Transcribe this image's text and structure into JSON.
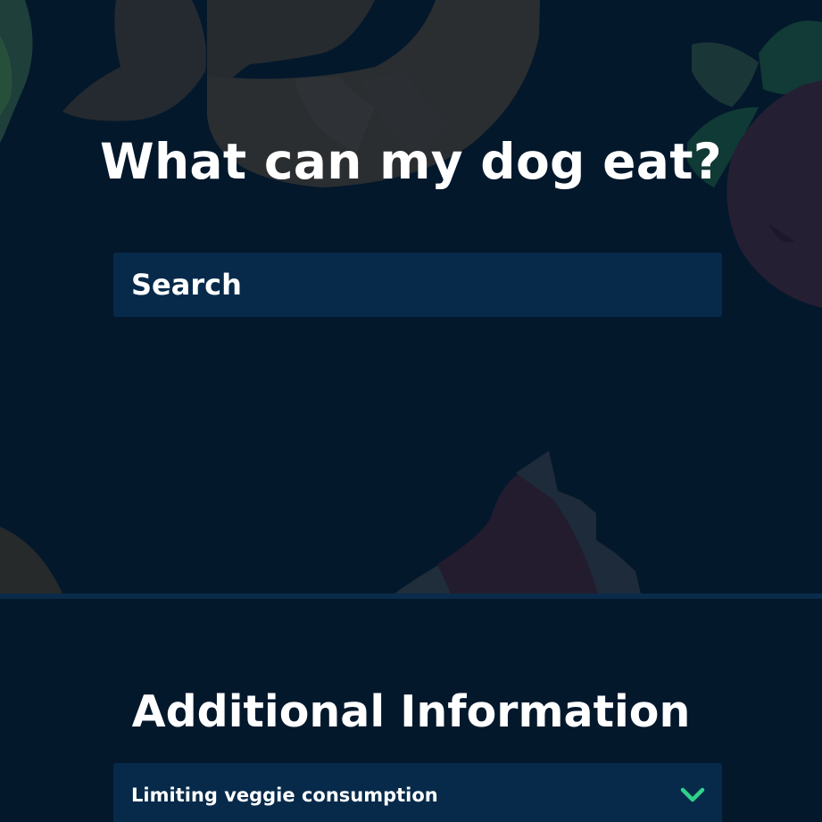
{
  "hero": {
    "title": "What can my dog eat?"
  },
  "search": {
    "placeholder": "Search",
    "value": ""
  },
  "info": {
    "title": "Additional Information",
    "items": [
      {
        "label": "Limiting veggie consumption",
        "icon": "chevron-down-icon"
      }
    ]
  },
  "colors": {
    "background": "#04182c",
    "input_background": "#072a4a",
    "accent": "#2fd18a",
    "text": "#ffffff"
  }
}
